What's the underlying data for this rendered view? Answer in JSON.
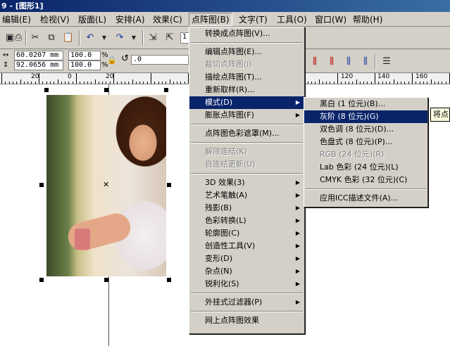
{
  "window": {
    "title": "9 - [图形1]"
  },
  "menubar": [
    "编辑(E)",
    "检视(V)",
    "版面(L)",
    "安排(A)",
    "效果(C)",
    "点阵图(B)",
    "文字(T)",
    "工具(O)",
    "窗口(W)",
    "帮助(H)"
  ],
  "propbar": {
    "x_value": "60.0207 mm",
    "y_value": "92.0656 mm",
    "scale_w": "100.0",
    "scale_h": "100.0",
    "pct": "%",
    "rotation": ".0",
    "zoom_partial": "1"
  },
  "ruler": {
    "labels": [
      "20",
      "0",
      "20",
      "120",
      "140",
      "160"
    ]
  },
  "bitmap_menu": {
    "items": [
      {
        "label": "转换成点阵图(V)...",
        "enabled": true
      },
      {
        "sep": true
      },
      {
        "label": "编辑点阵图(E)...",
        "enabled": true
      },
      {
        "label": "裁切点阵图(I)",
        "enabled": false
      },
      {
        "label": "描绘点阵图(T)...",
        "enabled": true
      },
      {
        "label": "重新取样(R)...",
        "enabled": true
      },
      {
        "label": "模式(D)",
        "enabled": true,
        "submenu": true,
        "highlighted": true
      },
      {
        "label": "膨胀点阵图(F)",
        "enabled": true,
        "submenu": true
      },
      {
        "sep": true
      },
      {
        "label": "点阵图色彩遮罩(M)...",
        "enabled": true
      },
      {
        "sep": true
      },
      {
        "label": "解除连结(K)",
        "enabled": false
      },
      {
        "label": "自连结更新(U)",
        "enabled": false
      },
      {
        "sep": true
      },
      {
        "label": "3D 效果(3)",
        "enabled": true,
        "submenu": true
      },
      {
        "label": "艺术笔触(A)",
        "enabled": true,
        "submenu": true
      },
      {
        "label": "残影(B)",
        "enabled": true,
        "submenu": true
      },
      {
        "label": "色彩转换(L)",
        "enabled": true,
        "submenu": true
      },
      {
        "label": "轮廓图(C)",
        "enabled": true,
        "submenu": true
      },
      {
        "label": "创造性工具(V)",
        "enabled": true,
        "submenu": true
      },
      {
        "label": "变形(D)",
        "enabled": true,
        "submenu": true
      },
      {
        "label": "杂点(N)",
        "enabled": true,
        "submenu": true
      },
      {
        "label": "锐利化(S)",
        "enabled": true,
        "submenu": true
      },
      {
        "sep": true
      },
      {
        "label": "外挂式过滤器(P)",
        "enabled": true,
        "submenu": true
      },
      {
        "sep": true
      },
      {
        "label": "网上点阵图效果",
        "enabled": true
      }
    ]
  },
  "mode_submenu": {
    "items": [
      {
        "label": "黑白 (1 位元)(B)...",
        "enabled": true
      },
      {
        "label": "灰阶 (8 位元)(G)",
        "enabled": true,
        "highlighted": true
      },
      {
        "label": "双色调 (8 位元)(D)...",
        "enabled": true
      },
      {
        "label": "色盘式 (8 位元)(P)...",
        "enabled": true
      },
      {
        "label": "RGB (24 位元)(R)",
        "enabled": false
      },
      {
        "label": "Lab 色彩 (24 位元)(L)",
        "enabled": true
      },
      {
        "label": "CMYK 色彩 (32 位元)(C)",
        "enabled": true
      },
      {
        "sep": true
      },
      {
        "label": "应用ICC描述文件(A)...",
        "enabled": true
      }
    ]
  },
  "tooltip": "将点阵图转换为灰阶"
}
